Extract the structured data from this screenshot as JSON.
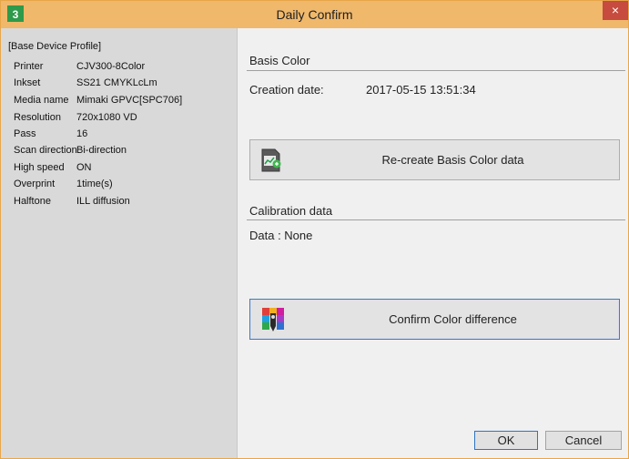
{
  "window": {
    "title": "Daily Confirm",
    "close_label": "×"
  },
  "profile": {
    "header": "[Base Device Profile]",
    "properties": [
      {
        "key": "Printer",
        "value": "CJV300-8Color"
      },
      {
        "key": "Inkset",
        "value": "SS21 CMYKLcLm"
      },
      {
        "key": "Media name",
        "value": "Mimaki GPVC[SPC706]"
      },
      {
        "key": "Resolution",
        "value": "720x1080 VD"
      },
      {
        "key": "Pass",
        "value": "16"
      },
      {
        "key": "Scan direction",
        "value": "Bi-direction"
      },
      {
        "key": "High speed",
        "value": "ON"
      },
      {
        "key": "Overprint",
        "value": "1time(s)"
      },
      {
        "key": "Halftone",
        "value": "ILL diffusion"
      }
    ]
  },
  "basis": {
    "title": "Basis Color",
    "creation_label": "Creation date:",
    "creation_value": "2017-05-15 13:51:34",
    "recreate_label": "Re-create Basis Color data"
  },
  "calibration": {
    "title": "Calibration data",
    "data_label": "Data : None",
    "confirm_label": "Confirm Color difference"
  },
  "footer": {
    "ok_label": "OK",
    "cancel_label": "Cancel"
  },
  "colors": {
    "titlebar": "#f0b86b",
    "close": "#c74b3f",
    "left_panel": "#d9d9d9"
  }
}
